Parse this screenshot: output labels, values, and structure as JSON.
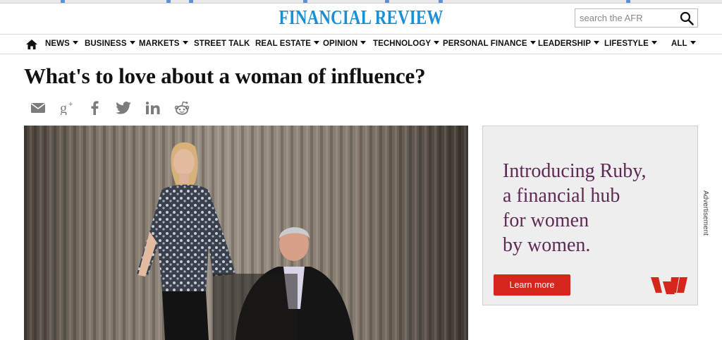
{
  "masthead": {
    "logo": "FINANCIAL REVIEW",
    "search_placeholder": "search the AFR"
  },
  "nav": {
    "items": [
      {
        "label": "NEWS",
        "has_caret": true
      },
      {
        "label": "BUSINESS",
        "has_caret": true
      },
      {
        "label": "MARKETS",
        "has_caret": true
      },
      {
        "label": "STREET TALK",
        "has_caret": false
      },
      {
        "label": "REAL ESTATE",
        "has_caret": true
      },
      {
        "label": "OPINION",
        "has_caret": true
      },
      {
        "label": "TECHNOLOGY",
        "has_caret": true
      },
      {
        "label": "PERSONAL FINANCE",
        "has_caret": true
      },
      {
        "label": "LEADERSHIP",
        "has_caret": true
      },
      {
        "label": "LIFESTYLE",
        "has_caret": true
      },
      {
        "label": "ALL",
        "has_caret": true
      }
    ]
  },
  "article": {
    "headline": "What's to love about a woman of influence?",
    "share_icons": [
      "email-icon",
      "google-plus-icon",
      "facebook-icon",
      "twitter-icon",
      "linkedin-icon",
      "reddit-icon"
    ]
  },
  "ad": {
    "lines": [
      "Introducing Ruby,",
      "a financial hub",
      "for women",
      "by women."
    ],
    "cta": "Learn more",
    "label": "Advertisement",
    "text_color": "#5e2a55",
    "cta_color": "#d5261c"
  },
  "colors": {
    "logo": "#1a8fd6",
    "icons": "#7c7c7c"
  }
}
